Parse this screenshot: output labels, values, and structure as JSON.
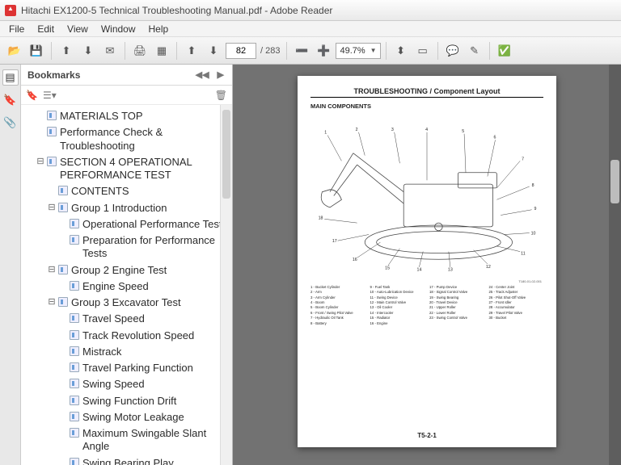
{
  "window": {
    "title": "Hitachi EX1200-5 Technical Troubleshooting Manual.pdf - Adobe Reader"
  },
  "menu": {
    "items": [
      "File",
      "Edit",
      "View",
      "Window",
      "Help"
    ]
  },
  "toolbar": {
    "page_current": "82",
    "page_total": "/ 283",
    "zoom_value": "49.7%"
  },
  "bookmarks": {
    "title": "Bookmarks",
    "tree": [
      {
        "label": "MATERIALS TOP",
        "indent": 1,
        "tw": ""
      },
      {
        "label": "Performance Check & Troubleshooting",
        "indent": 1,
        "tw": ""
      },
      {
        "label": "SECTION 4 OPERATIONAL PERFORMANCE TEST",
        "indent": 1,
        "tw": "⊟"
      },
      {
        "label": "CONTENTS",
        "indent": 2,
        "tw": ""
      },
      {
        "label": "Group 1 Introduction",
        "indent": 2,
        "tw": "⊟"
      },
      {
        "label": "Operational Performance Tests",
        "indent": 3,
        "tw": ""
      },
      {
        "label": "Preparation for Performance Tests",
        "indent": 3,
        "tw": ""
      },
      {
        "label": "Group 2 Engine Test",
        "indent": 2,
        "tw": "⊟"
      },
      {
        "label": "Engine Speed",
        "indent": 3,
        "tw": ""
      },
      {
        "label": "Group 3 Excavator Test",
        "indent": 2,
        "tw": "⊟"
      },
      {
        "label": "Travel Speed",
        "indent": 3,
        "tw": ""
      },
      {
        "label": "Track Revolution Speed",
        "indent": 3,
        "tw": ""
      },
      {
        "label": "Mistrack",
        "indent": 3,
        "tw": ""
      },
      {
        "label": "Travel Parking Function",
        "indent": 3,
        "tw": ""
      },
      {
        "label": "Swing Speed",
        "indent": 3,
        "tw": ""
      },
      {
        "label": "Swing Function Drift",
        "indent": 3,
        "tw": ""
      },
      {
        "label": "Swing Motor Leakage",
        "indent": 3,
        "tw": ""
      },
      {
        "label": "Maximum Swingable Slant Angle",
        "indent": 3,
        "tw": ""
      },
      {
        "label": "Swing Bearing Play",
        "indent": 3,
        "tw": ""
      }
    ]
  },
  "page": {
    "section": "TROUBLESHOOTING / Component Layout",
    "subtitle": "MAIN COMPONENTS",
    "figref": "T180-01-02-001",
    "pagenum": "T5-2-1",
    "legend": [
      "1 - Bucket Cylinder",
      "9 - Fuel Tank",
      "17 - Pump Device",
      "24 - Center Joint",
      "2 - Arm",
      "10 - Auto-Lubrication Device",
      "18 - Signal Control Valve",
      "25 - Track Adjuster",
      "3 - Arm Cylinder",
      "11 - Swing Device",
      "19 - Swing Bearing",
      "26 - Pilot Shut-Off Valve",
      "4 - Boom",
      "12 - Main Control Valve",
      "20 - Travel Device",
      "27 - Front Idler",
      "5 - Boom Cylinder",
      "13 - Oil Cooler",
      "21 - Upper Roller",
      "28 - Accumulator",
      "6 - Front / Swing Pilot Valve",
      "14 - Intercooler",
      "22 - Lower Roller",
      "29 - Travel Pilot Valve",
      "7 - Hydraulic Oil Tank",
      "15 - Radiator",
      "23 - Swing Control Valve",
      "30 - Bucket",
      "8 - Battery",
      "16 - Engine",
      "",
      ""
    ]
  }
}
